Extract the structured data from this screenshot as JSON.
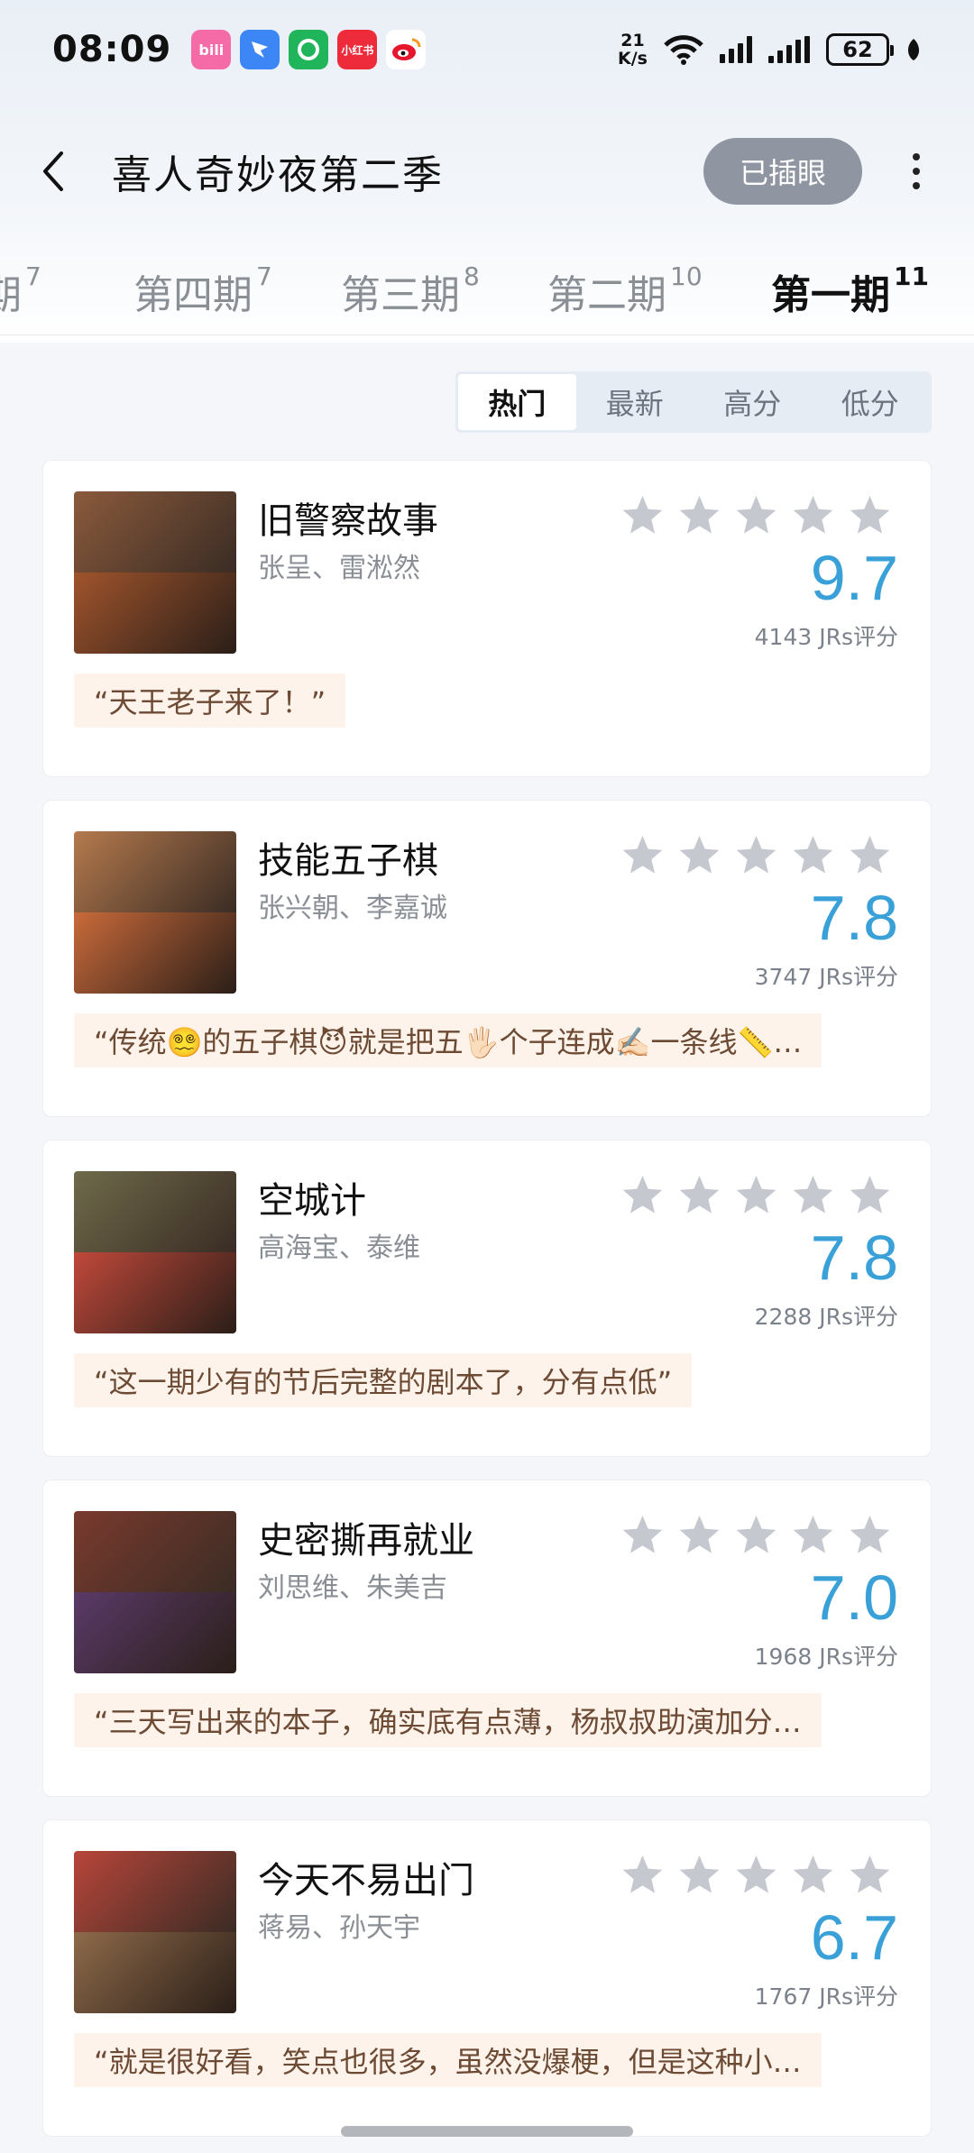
{
  "status_bar": {
    "time": "08:09",
    "net_speed_value": "21",
    "net_speed_unit": "K/s",
    "battery": "62",
    "apps": [
      {
        "icon": "bilibili-icon",
        "label": "bili",
        "color": "#f46ba8"
      },
      {
        "icon": "dingtalk-icon",
        "label": "",
        "color": "#3c86f5"
      },
      {
        "icon": "green-app-icon",
        "label": "",
        "color": "#20b45b"
      },
      {
        "icon": "xiaohongshu-icon",
        "label": "小红书",
        "color": "#ee2b3a"
      },
      {
        "icon": "weibo-icon",
        "label": "",
        "color": "#f3a33a"
      }
    ]
  },
  "header": {
    "title": "喜人奇妙夜第二季",
    "chip_label": "已插眼"
  },
  "episode_tabs": [
    {
      "label": "第四期",
      "count": "7",
      "active": false
    },
    {
      "label": "第三期",
      "count": "8",
      "active": false
    },
    {
      "label": "第二期",
      "count": "10",
      "active": false
    },
    {
      "label": "第一期",
      "count": "11",
      "active": true
    }
  ],
  "episode_partial": {
    "label": "期",
    "count": "7"
  },
  "sort_options": [
    {
      "label": "热门",
      "active": true
    },
    {
      "label": "最新",
      "active": false
    },
    {
      "label": "高分",
      "active": false
    },
    {
      "label": "低分",
      "active": false
    }
  ],
  "colors": {
    "accent_score": "#3aa0d8",
    "star_empty": "#c5c8ce",
    "chip_bg": "#8f96a1",
    "quote_bg": "#fdf3ea"
  },
  "items": [
    {
      "title": "旧警察故事",
      "cast": "张呈、雷淞然",
      "rating": 0,
      "score": "9.7",
      "votes": "4143 JRs评分",
      "quote": "“天王老子来了！”",
      "thumb_colors": [
        "#8b5a3c",
        "#a0542c"
      ]
    },
    {
      "title": "技能五子棋",
      "cast": "张兴朝、李嘉诚",
      "rating": 0,
      "score": "7.8",
      "votes": "3747 JRs评分",
      "quote": "“传统😵‍💫的五子棋😈就是把五🖐🏻个子连成✍🏻一条线📏…",
      "thumb_colors": [
        "#b57a4d",
        "#c96a3a"
      ]
    },
    {
      "title": "空城计",
      "cast": "高海宝、泰维",
      "rating": 0,
      "score": "7.8",
      "votes": "2288 JRs评分",
      "quote": "“这一期少有的节后完整的剧本了，分有点低”",
      "thumb_colors": [
        "#6e6a4a",
        "#c0483a"
      ]
    },
    {
      "title": "史密撕再就业",
      "cast": "刘思维、朱美吉",
      "rating": 0,
      "score": "7.0",
      "votes": "1968 JRs评分",
      "quote": "“三天写出来的本子，确实底有点薄，杨叔叔助演加分…",
      "thumb_colors": [
        "#7a3a2e",
        "#5a3a68"
      ]
    },
    {
      "title": "今天不易出门",
      "cast": "蒋易、孙天宇",
      "rating": 0,
      "score": "6.7",
      "votes": "1767 JRs评分",
      "quote": "“就是很好看，笑点也很多，虽然没爆梗，但是这种小…",
      "thumb_colors": [
        "#b8453a",
        "#8e6a4a"
      ]
    }
  ]
}
